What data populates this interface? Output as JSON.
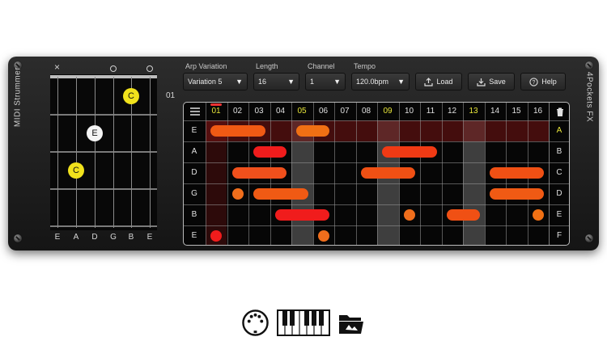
{
  "app": {
    "title_left": "MIDI Strummer",
    "title_right": "4Pockets FX"
  },
  "chord": {
    "fret_position": "01",
    "string_names": [
      "E",
      "A",
      "D",
      "G",
      "B",
      "E"
    ],
    "string_marks": [
      "×",
      "",
      "",
      "○",
      "",
      "○"
    ],
    "dots": [
      {
        "string": 4,
        "fret": 1,
        "label": "C",
        "color": "yellow"
      },
      {
        "string": 2,
        "fret": 2,
        "label": "E",
        "color": "white"
      },
      {
        "string": 1,
        "fret": 3,
        "label": "C",
        "color": "yellow"
      }
    ]
  },
  "controls": {
    "arp_variation": {
      "label": "Arp Variation",
      "value": "Variation 5"
    },
    "length": {
      "label": "Length",
      "value": "16"
    },
    "channel": {
      "label": "Channel",
      "value": "1"
    },
    "tempo": {
      "label": "Tempo",
      "value": "120.0bpm"
    },
    "load": {
      "label": "Load"
    },
    "save": {
      "label": "Save"
    },
    "help": {
      "label": "Help"
    }
  },
  "grid": {
    "steps": [
      "01",
      "02",
      "03",
      "04",
      "05",
      "06",
      "07",
      "08",
      "09",
      "10",
      "11",
      "12",
      "13",
      "14",
      "15",
      "16"
    ],
    "highlighted_steps": [
      "01",
      "05",
      "09",
      "13"
    ],
    "row_labels_left": [
      "E",
      "A",
      "D",
      "G",
      "B",
      "E"
    ],
    "row_labels_right": [
      "A",
      "B",
      "C",
      "D",
      "E",
      "F"
    ],
    "active_row_label": "A",
    "notes": [
      {
        "row": 0,
        "start": 1,
        "length": 3,
        "color": "#f05a14"
      },
      {
        "row": 0,
        "start": 5,
        "length": 2,
        "color": "#f07014"
      },
      {
        "row": 1,
        "start": 3,
        "length": 2,
        "color": "#f01c1c"
      },
      {
        "row": 1,
        "start": 9,
        "length": 3,
        "color": "#f03a14"
      },
      {
        "row": 2,
        "start": 2,
        "length": 3,
        "color": "#f0501c"
      },
      {
        "row": 2,
        "start": 8,
        "length": 3,
        "color": "#f05014"
      },
      {
        "row": 2,
        "start": 14,
        "length": 3,
        "color": "#f05014"
      },
      {
        "row": 3,
        "start": 2,
        "length": 1,
        "color": "#f06e1c"
      },
      {
        "row": 3,
        "start": 3,
        "length": 3,
        "color": "#f05a14"
      },
      {
        "row": 3,
        "start": 14,
        "length": 3,
        "color": "#f05a14"
      },
      {
        "row": 4,
        "start": 4,
        "length": 3,
        "color": "#f01c1c"
      },
      {
        "row": 4,
        "start": 10,
        "length": 1,
        "color": "#f06e1c"
      },
      {
        "row": 4,
        "start": 12,
        "length": 2,
        "color": "#f05014"
      },
      {
        "row": 4,
        "start": 16,
        "length": 1,
        "color": "#f07014"
      },
      {
        "row": 5,
        "start": 1,
        "length": 1,
        "color": "#f01c1c"
      },
      {
        "row": 5,
        "start": 6,
        "length": 1,
        "color": "#f06e1c"
      }
    ]
  },
  "bottom_icons": [
    "midi-din-icon",
    "piano-keyboard-icon",
    "folder-icon"
  ],
  "colors": {
    "step_active": "#e8e63a",
    "step_normal": "#e0e0e0",
    "active_row_label": "#e8e63a"
  }
}
